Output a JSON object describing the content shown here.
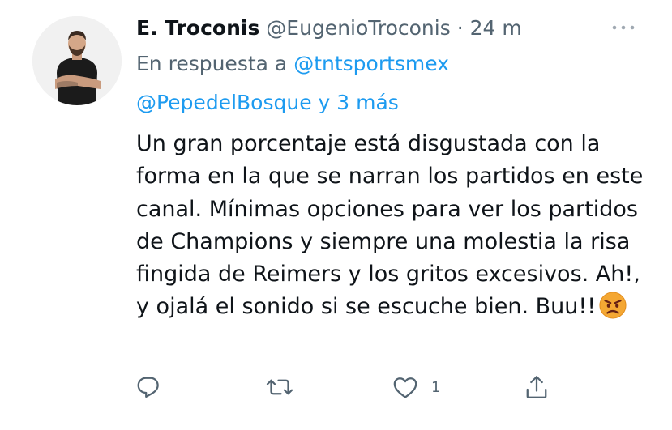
{
  "tweet": {
    "display_name": "E. Troconis",
    "handle": "@EugenioTroconis",
    "separator": "·",
    "time": "24 m",
    "reply_prefix": "En respuesta a",
    "reply_mention_1": "@tntsportsmex",
    "reply_mention_2": "@PepedelBosque",
    "reply_more": "y 3 más",
    "text": "Un gran porcentaje está disgustada con la forma en la que se narran los partidos en este canal. Mínimas opciones para ver los partidos de Champions y siempre una molestia la risa fingida de Reimers y los gritos excesivos. Ah!, y ojalá el sonido si se escuche bien. Buu!!",
    "emoji": "angry-face-emoji"
  },
  "actions": {
    "reply": {
      "icon": "reply-icon"
    },
    "retweet": {
      "icon": "retweet-icon"
    },
    "like": {
      "icon": "heart-icon",
      "count": "1"
    },
    "share": {
      "icon": "share-icon"
    }
  },
  "colors": {
    "text": "#0f1419",
    "muted": "#536471",
    "link": "#1d9bf0",
    "background": "#ffffff"
  }
}
